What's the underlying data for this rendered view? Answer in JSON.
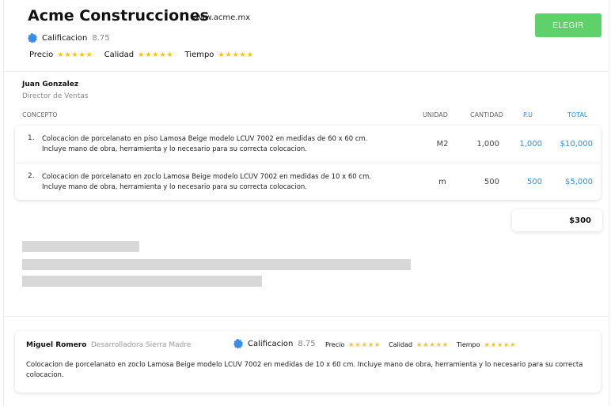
{
  "company": {
    "name": "Acme Construcciones",
    "url": "www.acme.mx",
    "rating_label": "Calificacion",
    "rating_value": "8.75",
    "select_label": "ELEGIR",
    "metrics": [
      {
        "label": "Precio",
        "stars": "★★★★★"
      },
      {
        "label": "Calidad",
        "stars": "★★★★★"
      },
      {
        "label": "Tiempo",
        "stars": "★★★★★"
      }
    ]
  },
  "contact": {
    "name": "Juan Gonzalez",
    "title": "Director de Ventas"
  },
  "table": {
    "headers": {
      "concepto": "CONCEPTO",
      "unidad": "UNIDAD",
      "cantidad": "CANTIDAD",
      "pu": "P.U",
      "total": "TOTAL"
    },
    "rows": [
      {
        "num": "1.",
        "desc": "Colocacion de porcelanato en piso Lamosa Beige modelo LCUV 7002 en medidas de 60 x 60 cm. Incluye mano de obra, herramienta y lo necesario para su correcta colocacion.",
        "unidad": "M2",
        "cantidad": "1,000",
        "pu": "1,000",
        "total": "$10,000"
      },
      {
        "num": "2.",
        "desc": "Colocacion de porcelanato en zoclo Lamosa Beige modelo LCUV 7002 en medidas de 10 x 60 cm. Incluye mano de obra, herramienta y lo necesario para su correcta colocacion.",
        "unidad": "m",
        "cantidad": "500",
        "pu": "500",
        "total": "$5,000"
      }
    ],
    "grand_total": "$300"
  },
  "review": {
    "author": "Miguel Romero",
    "company": "Desarrolladora Sierra Madre",
    "rating_label": "Calificacion",
    "rating_value": "8.75",
    "metrics": [
      {
        "label": "Precio",
        "stars": "★★★★★"
      },
      {
        "label": "Calidad",
        "stars": "★★★★★"
      },
      {
        "label": "Tiempo",
        "stars": "★★★★★"
      }
    ],
    "text": "Colocacion de porcelanato en zoclo Lamosa Beige modelo LCUV 7002 en medidas de 10 x 60 cm. Incluye mano de obra, herramienta y lo necesario para su correcta colocacion."
  },
  "colors": {
    "accent_green": "#5fd16a",
    "link_blue": "#2d8fe3",
    "star_yellow": "#f6c21b",
    "badge_blue": "#3b8ee8"
  },
  "icons": {
    "rating_badge": "verified-badge-icon",
    "star": "star-icon"
  }
}
